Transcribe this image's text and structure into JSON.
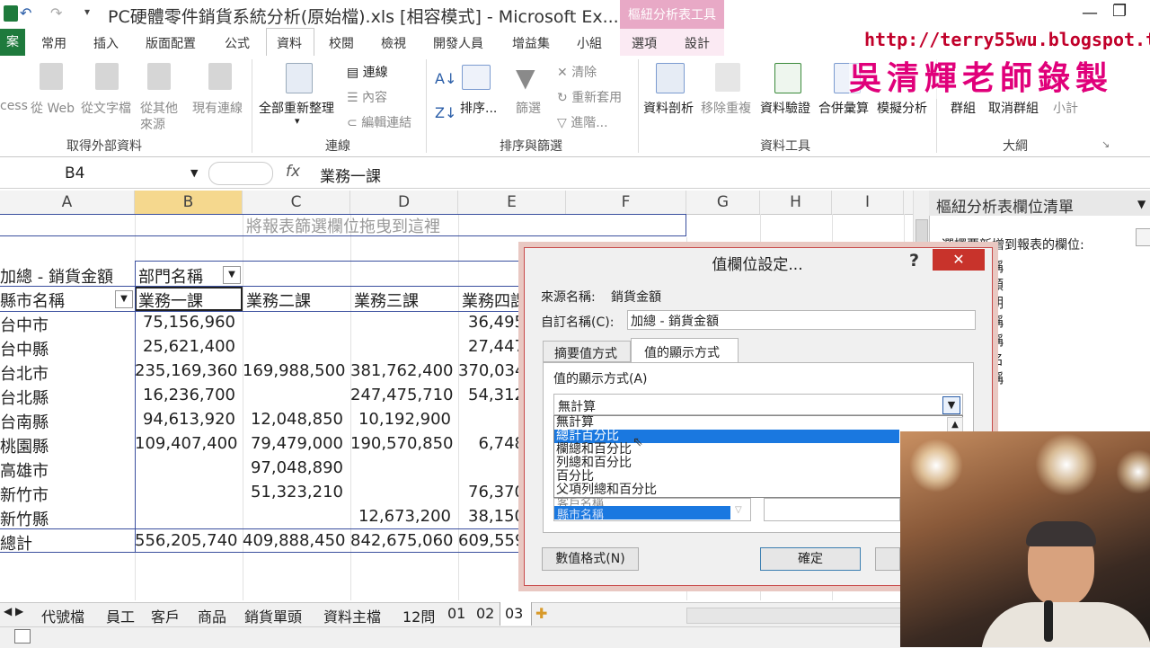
{
  "window": {
    "title": "PC硬體零件銷貨系統分析(原始檔).xls  [相容模式] - Microsoft Ex...",
    "context_title": "樞紐分析表工具",
    "controls": [
      "—",
      "❐"
    ]
  },
  "tabs": {
    "file": "案",
    "items": [
      "常用",
      "插入",
      "版面配置",
      "公式",
      "資料",
      "校閱",
      "檢視",
      "開發人員",
      "增益集",
      "小組",
      "選項",
      "設計"
    ]
  },
  "watermark": {
    "url": "http://terry55wu.blogspot.tw",
    "author": "吳清輝老師錄製"
  },
  "ribbon": {
    "external_data": {
      "items": [
        "cess",
        "從 Web",
        "從文字檔",
        "從其他",
        "來源",
        "現有連線"
      ],
      "group": "取得外部資料"
    },
    "connections": {
      "refresh_all": "全部重新整理",
      "connections": "連線",
      "properties": "內容",
      "edit_links": "編輯連結",
      "group": "連線"
    },
    "sort_filter": {
      "sort": "排序...",
      "filter": "篩選",
      "clear": "清除",
      "reapply": "重新套用",
      "advanced": "進階...",
      "group": "排序與篩選"
    },
    "data_tools": {
      "items": [
        "資料剖析",
        "移除重複",
        "資料驗證",
        "合併彙算",
        "模擬分析"
      ],
      "group": "資料工具"
    },
    "outline": {
      "items": [
        "群組",
        "取消群組",
        "小計"
      ],
      "group": "大綱"
    }
  },
  "formula_bar": {
    "name_box": "B4",
    "fx": "fx",
    "value": "業務一課"
  },
  "grid": {
    "columns": [
      "A",
      "B",
      "C",
      "D",
      "E",
      "F",
      "G",
      "H",
      "I"
    ],
    "drop_zone": "將報表篩選欄位拖曳到這裡",
    "sum_label": "加總 - 銷貨金額",
    "col_field": "部門名稱",
    "row_field": "縣市名稱",
    "headers": [
      "業務一課",
      "業務二課",
      "業務三課",
      "業務四課"
    ],
    "rows": [
      {
        "name": "台中市",
        "b": "75,156,960",
        "c": "",
        "d": "",
        "e": "36,495"
      },
      {
        "name": "台中縣",
        "b": "25,621,400",
        "c": "",
        "d": "",
        "e": "27,447"
      },
      {
        "name": "台北市",
        "b": "235,169,360",
        "c": "169,988,500",
        "d": "381,762,400",
        "e": "370,034"
      },
      {
        "name": "台北縣",
        "b": "16,236,700",
        "c": "",
        "d": "247,475,710",
        "e": "54,312"
      },
      {
        "name": "台南縣",
        "b": "94,613,920",
        "c": "12,048,850",
        "d": "10,192,900",
        "e": ""
      },
      {
        "name": "桃園縣",
        "b": "109,407,400",
        "c": "79,479,000",
        "d": "190,570,850",
        "e": "6,748"
      },
      {
        "name": "高雄市",
        "b": "",
        "c": "97,048,890",
        "d": "",
        "e": ""
      },
      {
        "name": "新竹市",
        "b": "",
        "c": "51,323,210",
        "d": "",
        "e": "76,370"
      },
      {
        "name": "新竹縣",
        "b": "",
        "c": "",
        "d": "12,673,200",
        "e": "38,150"
      }
    ],
    "total": {
      "name": "總計",
      "b": "556,205,740",
      "c": "409,888,450",
      "d": "842,675,060",
      "e": "609,559"
    }
  },
  "sheets": [
    "代號檔",
    "員工",
    "客戶",
    "商品",
    "銷貨單頭",
    "資料主檔",
    "12問",
    "01",
    "02",
    "03"
  ],
  "pane": {
    "title": "樞紐分析表欄位清單",
    "prompt": "選擇要新增到報表的欄位:",
    "fields": [
      "稱",
      "額",
      "期",
      "稱",
      "稱",
      "名",
      "稱"
    ]
  },
  "dialog": {
    "title": "值欄位設定...",
    "help": "?",
    "source_label": "來源名稱:",
    "source_value": "銷貨金額",
    "custom_label": "自訂名稱(C):",
    "custom_value": "加總 - 銷貨金額",
    "tab_summarize": "摘要值方式",
    "tab_show_as": "值的顯示方式",
    "show_as_label": "值的顯示方式(A)",
    "selected": "無計算",
    "options": [
      "無計算",
      "總計百分比",
      "欄總和百分比",
      "列總和百分比",
      "百分比",
      "父項列總和百分比"
    ],
    "base_field_items": [
      "客戶名稱",
      "縣市名稱"
    ],
    "number_format": "數值格式(N)",
    "ok": "確定"
  }
}
